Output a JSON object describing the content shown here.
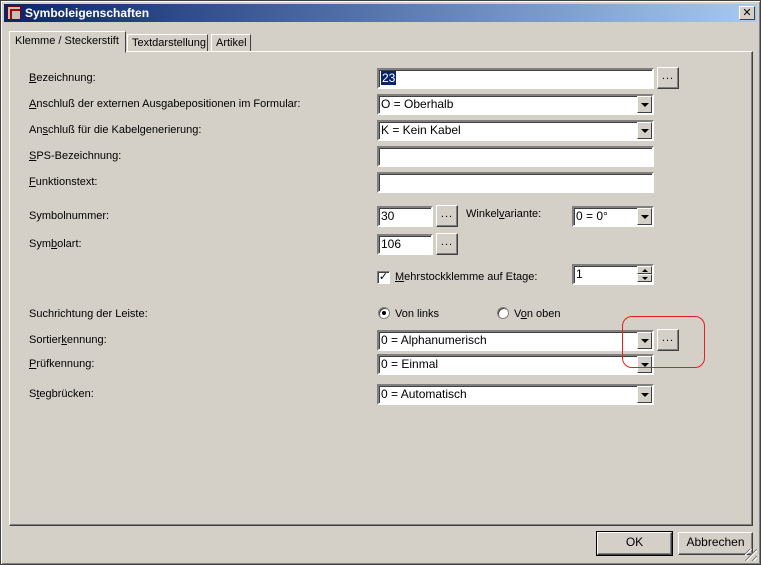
{
  "window": {
    "title": "Symboleigenschaften"
  },
  "tabs": [
    {
      "label": "Klemme / Steckerstift"
    },
    {
      "label": "Textdarstellung"
    },
    {
      "label": "Artikel"
    }
  ],
  "form": {
    "bezeichnung": {
      "label_u": "B",
      "label_rest": "ezeichnung:",
      "value": "23"
    },
    "anschluss_ausgabe": {
      "label_u": "A",
      "label_rest": "nschluß der externen Ausgabepositionen im Formular:",
      "value": "O = Oberhalb"
    },
    "anschluss_kabel": {
      "label_pre": "An",
      "label_u": "s",
      "label_rest": "chluß für die Kabelgenerierung:",
      "value": "K = Kein Kabel"
    },
    "sps": {
      "label_u": "S",
      "label_rest": "PS-Bezeichnung:",
      "value": ""
    },
    "funktionstext": {
      "label_u": "F",
      "label_rest": "unktionstext:",
      "value": ""
    },
    "symbolnummer": {
      "label": "Symbolnummer:",
      "value": "30"
    },
    "winkelvariante": {
      "label_pre": "Winkel",
      "label_u": "v",
      "label_rest": "ariante:",
      "value": "0 = 0°"
    },
    "symbolart": {
      "label_pre": "Sym",
      "label_u": "b",
      "label_rest": "olart:",
      "value": "106"
    },
    "mehrstock": {
      "label_u": "M",
      "label_rest": "ehrstockklemme auf Etage:",
      "checked": true,
      "value": "1"
    },
    "suchrichtung": {
      "label": "Suchrichtung der Leiste:",
      "opt1": "Von links",
      "opt2_pre": "V",
      "opt2_u": "o",
      "opt2_rest": "n oben"
    },
    "sortierkennung": {
      "label_pre": "Sortier",
      "label_u": "k",
      "label_rest": "ennung:",
      "value": "0 = Alphanumerisch"
    },
    "pruefkennung": {
      "label_u": "P",
      "label_rest": "rüfkennung:",
      "value": "0 = Einmal"
    },
    "stegbruecken": {
      "label_pre": "S",
      "label_u": "t",
      "label_rest": "egbrücken:",
      "value": "0 = Automatisch"
    }
  },
  "ellipsis": "...",
  "buttons": {
    "ok": "OK",
    "cancel": "Abbrechen"
  },
  "colors": {
    "highlight": "#e02020",
    "title_start": "#0a246a",
    "title_end": "#a6caf0"
  }
}
